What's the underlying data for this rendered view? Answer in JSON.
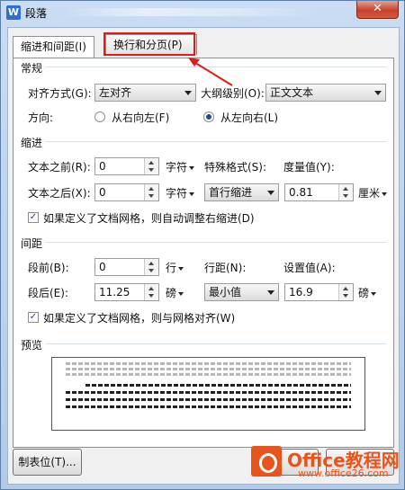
{
  "window": {
    "title": "段落",
    "close_glyph": "✕",
    "app_icon_glyph": "W"
  },
  "tabs": [
    {
      "label": "缩进和间距(I)",
      "active": true
    },
    {
      "label": "换行和分页(P)",
      "active": false
    }
  ],
  "general": {
    "section_title": "常规",
    "alignment_label": "对齐方式(G):",
    "alignment_value": "左对齐",
    "outline_label": "大纲级别(O):",
    "outline_value": "正文文本",
    "direction_label": "方向:",
    "rtl_label": "从右向左(F)",
    "ltr_label": "从左向右(L)",
    "selected_direction": "ltr"
  },
  "indent": {
    "section_title": "缩进",
    "before_label": "文本之前(R):",
    "before_value": "0",
    "before_unit": "字符",
    "after_label": "文本之后(X):",
    "after_value": "0",
    "after_unit": "字符",
    "special_label": "特殊格式(S):",
    "special_value": "首行缩进",
    "measure_label": "度量值(Y):",
    "measure_value": "0.81",
    "measure_unit": "厘米",
    "grid_checkbox_label": "如果定义了文档网格，则自动调整右缩进(D)",
    "grid_checked": true
  },
  "spacing": {
    "section_title": "间距",
    "before_label": "段前(B):",
    "before_value": "0",
    "before_unit": "行",
    "after_label": "段后(E):",
    "after_value": "11.25",
    "after_unit": "磅",
    "line_label": "行距(N):",
    "line_value": "最小值",
    "setting_label": "设置值(A):",
    "setting_value": "16.9",
    "setting_unit": "磅",
    "grid_checkbox_label": "如果定义了文档网格，则与网格对齐(W)",
    "grid_checked": true
  },
  "preview": {
    "section_title": "预览"
  },
  "footer": {
    "tabs_button": "制表位(T)..."
  },
  "watermark": {
    "brand": "Office教程网",
    "site": "www.office26.com"
  },
  "colors": {
    "highlight": "#e01b1b",
    "watermark": "#e8541d"
  }
}
